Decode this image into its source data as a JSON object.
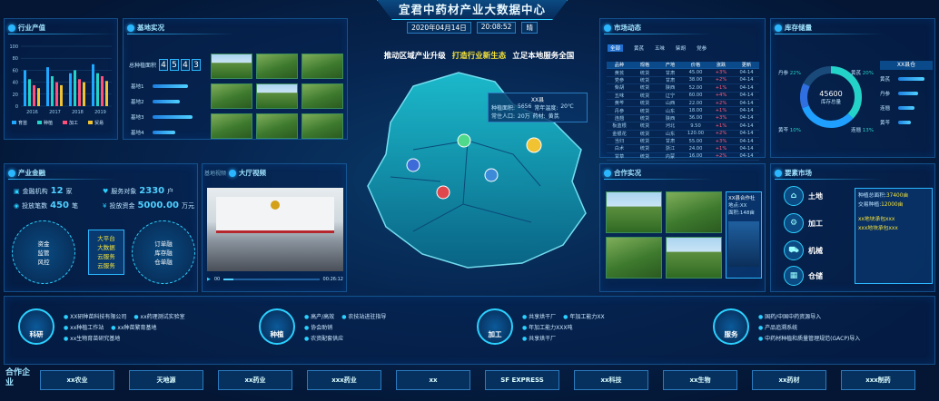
{
  "header": {
    "title": "宜君中药材产业大数据中心",
    "date": "2020年04月14日",
    "time": "20:08:52",
    "weekday": "晴"
  },
  "slogan": {
    "a": "推动区域产业升级",
    "b": "打造行业新生态",
    "c": "立足本地服务全国"
  },
  "panels": {
    "industry_output": "行业产值",
    "base": "基地实况",
    "finance": "产业金融",
    "video": "大厅视频",
    "video_tab": "基地视频",
    "market": "市场动态",
    "inventory": "库存储量",
    "cooperative": "合作实况",
    "trade": "要素市场"
  },
  "industry_chart": {
    "type": "bar",
    "categories": [
      "2016",
      "2017",
      "2018",
      "2019"
    ],
    "ylim": [
      0,
      100
    ],
    "yticks": [
      "100",
      "80",
      "60",
      "40",
      "20",
      "0"
    ],
    "legend": [
      "育苗",
      "种植",
      "加工",
      "贸易"
    ],
    "colors": [
      "#1fa8ff",
      "#24d3c8",
      "#ff4f7a",
      "#f1c232"
    ],
    "series": [
      {
        "name": "育苗",
        "values": [
          60,
          65,
          55,
          70
        ]
      },
      {
        "name": "种植",
        "values": [
          45,
          50,
          60,
          55
        ]
      },
      {
        "name": "加工",
        "values": [
          35,
          40,
          45,
          50
        ]
      },
      {
        "name": "贸易",
        "values": [
          30,
          35,
          40,
          42
        ]
      }
    ]
  },
  "base": {
    "area_label": "总种植面积",
    "area_digits": [
      "4",
      "5",
      "4",
      "3"
    ],
    "items": [
      {
        "label": "基地1",
        "fill": 0.7
      },
      {
        "label": "基地2",
        "fill": 0.55
      },
      {
        "label": "基地3",
        "fill": 0.8
      },
      {
        "label": "基地4",
        "fill": 0.45
      }
    ]
  },
  "finance": {
    "inst_label": "金融机构",
    "inst_value": "12",
    "inst_unit": "家",
    "serve_label": "服务对象",
    "serve_value": "2330",
    "serve_unit": "户",
    "count_label": "投放笔数",
    "count_value": "450",
    "count_unit": "笔",
    "amount_label": "投放资金",
    "amount_value": "5000.00",
    "amount_unit": "万元",
    "center": "资金\n监管\n风控",
    "center_list": [
      "大平台",
      "大数据",
      "云服务",
      "云服务"
    ],
    "center_right": "订单融\n库存融\n仓单融"
  },
  "video": {
    "start": "00",
    "end": "00:26:12"
  },
  "map": {
    "popup_title": "XX县",
    "popup_rows": [
      [
        "种植面积:",
        "5656",
        "常年温度:",
        "20℃"
      ],
      [
        "常住人口:",
        "20万",
        "药材:",
        "黄芪"
      ]
    ]
  },
  "market": {
    "tabs": [
      "全部",
      "黄芪",
      "五味",
      "柴胡",
      "党参"
    ],
    "head": [
      "品种",
      "规格",
      "产地",
      "价格",
      "涨跌",
      "更新"
    ],
    "rows": [
      [
        "黄芪",
        "统货",
        "甘肃",
        "45.00",
        "+3%",
        "04-14"
      ],
      [
        "党参",
        "统货",
        "甘肃",
        "38.00",
        "+2%",
        "04-14"
      ],
      [
        "柴胡",
        "统货",
        "陕西",
        "52.00",
        "+1%",
        "04-14"
      ],
      [
        "五味",
        "统货",
        "辽宁",
        "60.00",
        "+4%",
        "04-14"
      ],
      [
        "黄芩",
        "统货",
        "山西",
        "22.00",
        "+2%",
        "04-14"
      ],
      [
        "丹参",
        "统货",
        "山东",
        "18.00",
        "+1%",
        "04-14"
      ],
      [
        "连翘",
        "统货",
        "陕西",
        "36.00",
        "+3%",
        "04-14"
      ],
      [
        "板蓝根",
        "统货",
        "河北",
        "9.50",
        "+1%",
        "04-14"
      ],
      [
        "金银花",
        "统货",
        "山东",
        "120.00",
        "+2%",
        "04-14"
      ],
      [
        "当归",
        "统货",
        "甘肃",
        "55.00",
        "+3%",
        "04-14"
      ],
      [
        "白术",
        "统货",
        "浙江",
        "24.00",
        "+1%",
        "04-14"
      ],
      [
        "甘草",
        "统货",
        "内蒙",
        "16.00",
        "+2%",
        "04-14"
      ]
    ]
  },
  "inventory": {
    "total": "45600",
    "total_label": "库存总量",
    "labels": [
      {
        "t": "丹参",
        "p": "22%"
      },
      {
        "t": "黄芪",
        "p": "20%"
      },
      {
        "t": "黄芩",
        "p": "10%"
      },
      {
        "t": "连翘",
        "p": "13%"
      }
    ],
    "region": "XX县仓",
    "bars": [
      {
        "t": "黄芪",
        "v": 0.8
      },
      {
        "t": "丹参",
        "v": 0.6
      },
      {
        "t": "连翘",
        "v": 0.5
      },
      {
        "t": "黄芩",
        "v": 0.4
      }
    ]
  },
  "coop": {
    "name": "XX县合作社",
    "area_label": "地点:",
    "area_value": "XX",
    "count_label": "面积:",
    "count_value": "148亩"
  },
  "trade": {
    "items": [
      "土地",
      "加工",
      "机械",
      "仓储"
    ],
    "area_label": "种植总面积:",
    "area_value": "37400亩",
    "deal_label": "交易种植:",
    "deal_value": "12000亩",
    "links": [
      "xx地块承包xxx",
      "xxx地块承包xxx"
    ]
  },
  "bottom": [
    {
      "label": "科研",
      "items": [
        [
          "XX研种苗科技有限公司",
          "xx药理测试实验室"
        ],
        [
          "xx种植工作站",
          "xx种苗繁育基地"
        ],
        [
          "xx生物育苗研究基地",
          ""
        ]
      ]
    },
    {
      "label": "种植",
      "items": [
        [
          "高产/高效",
          "农技站进驻指导"
        ],
        [
          "协会助销",
          ""
        ],
        [
          "农资配套供应",
          ""
        ]
      ]
    },
    {
      "label": "加工",
      "items": [
        [
          "共享烘干厂",
          "年加工能力XX"
        ],
        [
          "年加工能力XXX吨",
          ""
        ],
        [
          "共享烘干厂",
          ""
        ]
      ]
    },
    {
      "label": "服务",
      "items": [
        [
          "国药/中国中药资源导入",
          ""
        ],
        [
          "产品追溯系统",
          ""
        ],
        [
          "中药材种植和质量管理规范(GACP)导入",
          ""
        ]
      ]
    }
  ],
  "partners": {
    "label": "合作企业",
    "logos": [
      "xx农业",
      "天地源",
      "xx药业",
      "xxx药业",
      "xx",
      "SF EXPRESS",
      "xx科技",
      "xx生物",
      "xx药材",
      "xxx制药"
    ]
  }
}
